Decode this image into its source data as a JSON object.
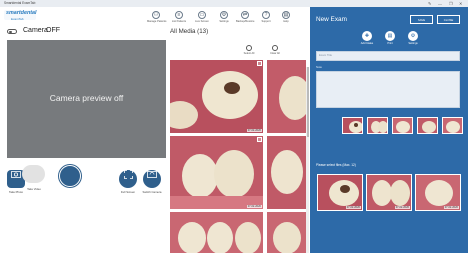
{
  "window": {
    "title": "Smartdental ExamTab",
    "controls": [
      "✎",
      "—",
      "❐",
      "✕"
    ]
  },
  "logo": {
    "line1": "smartdental",
    "line2": "ExamTab"
  },
  "toolbar": [
    {
      "id": "manage-patients",
      "label": "Manage Patients",
      "icon": "user-group-icon",
      "glyph": "👥"
    },
    {
      "id": "list-patients",
      "label": "List Patients",
      "icon": "list-icon",
      "glyph": "≡"
    },
    {
      "id": "live-screen",
      "label": "Live Screen",
      "icon": "monitor-icon",
      "glyph": "▭"
    },
    {
      "id": "settings",
      "label": "Settings",
      "icon": "gear-icon",
      "glyph": "⚙"
    },
    {
      "id": "backup-restore",
      "label": "Backup/Restore",
      "icon": "sync-icon",
      "glyph": "⇄"
    },
    {
      "id": "support",
      "label": "Support",
      "icon": "help-icon",
      "glyph": "?"
    },
    {
      "id": "help",
      "label": "Help",
      "icon": "book-icon",
      "glyph": "▤"
    }
  ],
  "camera": {
    "label": "Camera",
    "state": "OFF",
    "preview_message": "Camera preview off",
    "buttons": {
      "take_photo": "Take Photo",
      "take_video": "Take Video",
      "full_screen": "Full Screen",
      "switch_camera": "Switch Camera"
    }
  },
  "media": {
    "title": "All Media (13)",
    "select_all": "Select All",
    "clear_all": "Clear All",
    "thumbs": [
      {
        "date": "07-02-2020"
      },
      {
        "date": ""
      },
      {
        "date": "07-02-2020"
      },
      {
        "date": ""
      },
      {
        "date": ""
      },
      {
        "date": ""
      }
    ]
  },
  "exam": {
    "title": "New Exam",
    "save": "SAVE",
    "close": "CLOSE",
    "actions": [
      "Add Intake",
      "Print",
      "Settings"
    ],
    "title_placeholder": "Exam Title",
    "note_label": "Note",
    "select_label": "Please select files (Max. 12)",
    "big_thumbs": [
      {
        "date": "07-02-2020"
      },
      {
        "date": "07-02-2020"
      },
      {
        "date": "07-02-2020"
      }
    ]
  },
  "colors": {
    "accent": "#2d6aa8",
    "camera_button": "#2f5f8c",
    "preview": "#777a7d"
  }
}
